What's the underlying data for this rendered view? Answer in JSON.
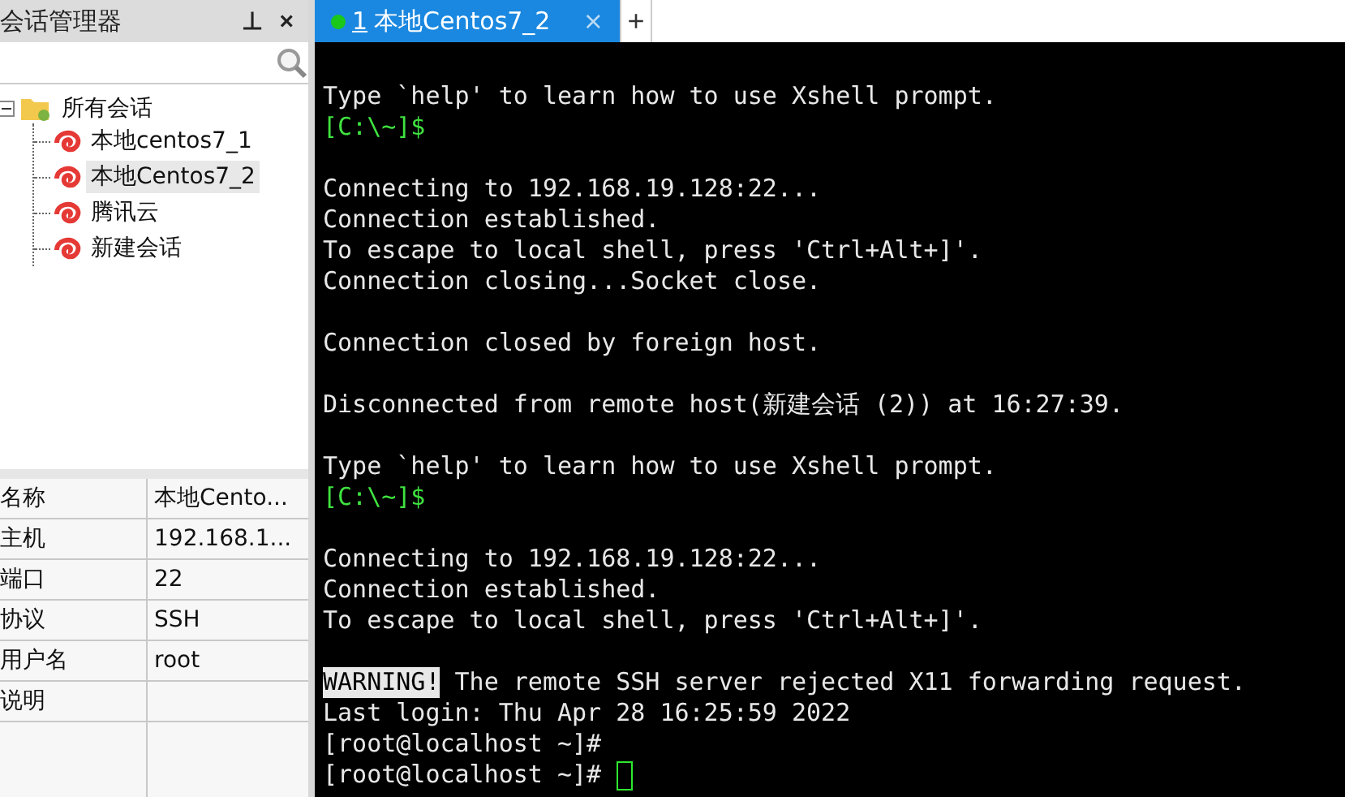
{
  "session_panel": {
    "title": "会话管理器",
    "pin": "⊥",
    "close": "×",
    "tree": [
      {
        "label": "所有会话",
        "kind": "folder",
        "expanded": true,
        "selected": false,
        "children": [
          {
            "label": "本地centos7_1",
            "kind": "session",
            "selected": false
          },
          {
            "label": "本地Centos7_2",
            "kind": "session",
            "selected": true
          },
          {
            "label": "腾讯云",
            "kind": "session",
            "selected": false
          },
          {
            "label": "新建会话",
            "kind": "session",
            "selected": false
          }
        ]
      }
    ],
    "properties": [
      {
        "name": "名称",
        "value": "本地Cento..."
      },
      {
        "name": "主机",
        "value": "192.168.1..."
      },
      {
        "name": "端口",
        "value": "22"
      },
      {
        "name": "协议",
        "value": "SSH"
      },
      {
        "name": "用户名",
        "value": "root"
      },
      {
        "name": "说明"
      }
    ]
  },
  "tabs": [
    {
      "number": "1",
      "label": "本地Centos7_2",
      "close": "×",
      "connected": true,
      "selected": true
    }
  ],
  "new_tab": "+",
  "terminal": [
    {
      "kind": "text",
      "text": "Type `help' to learn how to use Xshell prompt."
    },
    {
      "kind": "prompt",
      "text": "[C:\\~]$"
    },
    {
      "kind": "blank"
    },
    {
      "kind": "text",
      "text": "Connecting to 192.168.19.128:22..."
    },
    {
      "kind": "text",
      "text": "Connection established."
    },
    {
      "kind": "text",
      "text": "To escape to local shell, press 'Ctrl+Alt+]'."
    },
    {
      "kind": "text",
      "text": "Connection closing...Socket close."
    },
    {
      "kind": "blank"
    },
    {
      "kind": "text",
      "text": "Connection closed by foreign host."
    },
    {
      "kind": "blank"
    },
    {
      "kind": "text",
      "text": "Disconnected from remote host(新建会话 (2)) at 16:27:39."
    },
    {
      "kind": "blank"
    },
    {
      "kind": "text",
      "text": "Type `help' to learn how to use Xshell prompt."
    },
    {
      "kind": "prompt",
      "text": "[C:\\~]$"
    },
    {
      "kind": "blank"
    },
    {
      "kind": "text",
      "text": "Connecting to 192.168.19.128:22..."
    },
    {
      "kind": "text",
      "text": "Connection established."
    },
    {
      "kind": "text",
      "text": "To escape to local shell, press 'Ctrl+Alt+]'."
    },
    {
      "kind": "blank"
    },
    {
      "kind": "warning",
      "mark": "WARNING!",
      "text": " The remote SSH server rejected X11 forwarding request."
    },
    {
      "kind": "text",
      "text": "Last login: Thu Apr 28 16:25:59 2022"
    },
    {
      "kind": "text",
      "text": "[root@localhost ~]#"
    },
    {
      "kind": "input",
      "text": "[root@localhost ~]#"
    }
  ]
}
